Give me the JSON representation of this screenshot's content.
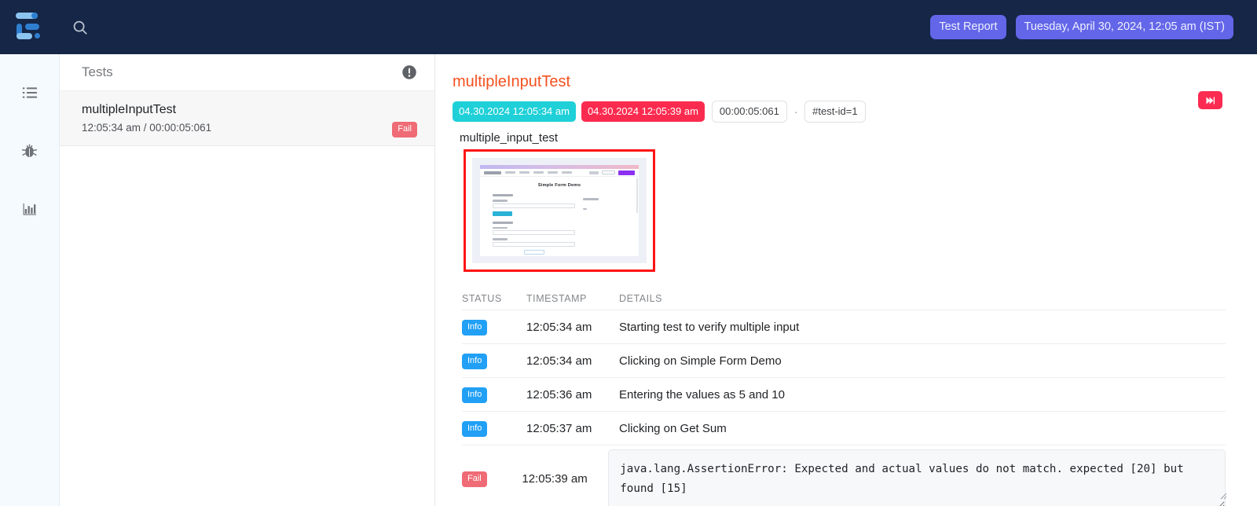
{
  "topbar": {
    "logo_name": "app-logo",
    "search_icon": "search-icon",
    "report_label": "Test Report",
    "date_label": "Tuesday, April 30, 2024, 12:05 am (IST)",
    "accent": "#6366e8",
    "background": "#152647"
  },
  "rail": {
    "items": [
      {
        "icon": "list-icon",
        "name": "sidebar-item-tests"
      },
      {
        "icon": "bug-icon",
        "name": "sidebar-item-issues"
      },
      {
        "icon": "bar-chart-icon",
        "name": "sidebar-item-analytics"
      }
    ]
  },
  "tests_panel": {
    "title": "Tests",
    "alert_icon": "alert-circle-icon",
    "rows": [
      {
        "name": "multipleInputTest",
        "meta": "12:05:34 am / 00:00:05:061",
        "status": "Fail",
        "status_color": "#ef6b75"
      }
    ]
  },
  "detail": {
    "title": "multipleInputTest",
    "title_color": "#f4511e",
    "start_time": "04.30.2024 12:05:34 am",
    "end_time": "04.30.2024 12:05:39 am",
    "duration": "00:00:05:061",
    "separator": "·",
    "test_id": "#test-id=1",
    "skip_icon": "skip-forward-icon",
    "snapshot_label": "multiple_input_test",
    "screenshot": {
      "name": "screenshot-thumbnail",
      "page_title": "Simple Form Demo",
      "border_color": "#ff1414"
    },
    "log_columns": [
      "STATUS",
      "TIMESTAMP",
      "DETAILS"
    ],
    "log_rows": [
      {
        "status": "Info",
        "status_color": "#21a0f5",
        "timestamp": "12:05:34 am",
        "details": "Starting test to verify multiple input"
      },
      {
        "status": "Info",
        "status_color": "#21a0f5",
        "timestamp": "12:05:34 am",
        "details": "Clicking on Simple Form Demo"
      },
      {
        "status": "Info",
        "status_color": "#21a0f5",
        "timestamp": "12:05:36 am",
        "details": "Entering the values as 5 and 10"
      },
      {
        "status": "Info",
        "status_color": "#21a0f5",
        "timestamp": "12:05:37 am",
        "details": "Clicking on Get Sum"
      }
    ],
    "error_row": {
      "status": "Fail",
      "status_color": "#ef6b75",
      "timestamp": "12:05:39 am",
      "error_text": "java.lang.AssertionError: Expected and actual values do not match. expected [20] but found [15]"
    }
  }
}
